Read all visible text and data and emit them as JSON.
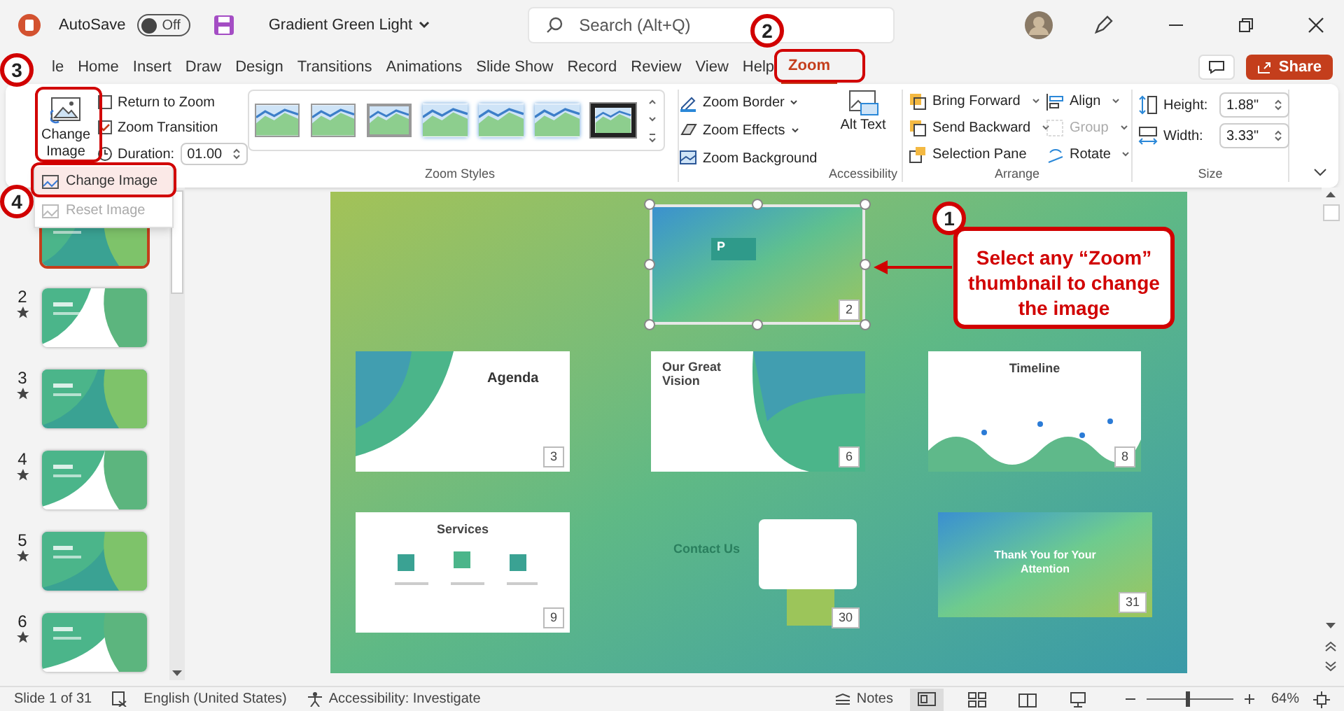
{
  "title_bar": {
    "autosave_label": "AutoSave",
    "autosave": {
      "on": false,
      "label": "Off"
    },
    "file_name": "Gradient Green Light",
    "search_placeholder": "Search (Alt+Q)"
  },
  "tabs": [
    {
      "label": "le",
      "selected": false
    },
    {
      "label": "Home",
      "selected": false
    },
    {
      "label": "Insert",
      "selected": false
    },
    {
      "label": "Draw",
      "selected": false
    },
    {
      "label": "Design",
      "selected": false
    },
    {
      "label": "Transitions",
      "selected": false
    },
    {
      "label": "Animations",
      "selected": false
    },
    {
      "label": "Slide Show",
      "selected": false
    },
    {
      "label": "Record",
      "selected": false
    },
    {
      "label": "Review",
      "selected": false
    },
    {
      "label": "View",
      "selected": false
    },
    {
      "label": "Help",
      "selected": false
    },
    {
      "label": "Zoom",
      "selected": true
    }
  ],
  "share_label": "Share",
  "ribbon": {
    "change_image": {
      "label": "Change Image"
    },
    "options": [
      {
        "label": "Return to Zoom",
        "checked": false
      },
      {
        "label": "Zoom Transition",
        "checked": true
      }
    ],
    "duration": {
      "label": "Duration:",
      "value": "01.00"
    },
    "zoom_styles": {
      "styles": [
        {
          "kind": "thin"
        },
        {
          "kind": "thin"
        },
        {
          "kind": "gray"
        },
        {
          "kind": "soft"
        },
        {
          "kind": "soft"
        },
        {
          "kind": "soft"
        },
        {
          "kind": "black"
        }
      ],
      "buttons": [
        {
          "label": "Zoom Border"
        },
        {
          "label": "Zoom Effects"
        },
        {
          "label": "Zoom Background"
        }
      ],
      "label": "Zoom Styles"
    },
    "accessibility": {
      "button": "Alt Text",
      "label": "Accessibility"
    },
    "arrange": {
      "items": [
        {
          "label": "Bring Forward",
          "disabled": false
        },
        {
          "label": "Send Backward",
          "disabled": false
        },
        {
          "label": "Selection Pane",
          "disabled": false
        },
        {
          "label": "Align",
          "disabled": false
        },
        {
          "label": "Group",
          "disabled": true
        },
        {
          "label": "Rotate",
          "disabled": false
        }
      ],
      "label": "Arrange"
    },
    "size": {
      "fields": [
        {
          "label": "Height:",
          "value": "1.88\""
        },
        {
          "label": "Width:",
          "value": "3.33\""
        }
      ],
      "label": "Size"
    }
  },
  "image_menu": [
    {
      "label": "Change Image",
      "selected": true,
      "disabled": false
    },
    {
      "label": "Reset Image",
      "selected": false,
      "disabled": true
    }
  ],
  "slides": [
    {
      "selected": true
    },
    {
      "number": "2",
      "selected": false
    },
    {
      "number": "3",
      "selected": false
    },
    {
      "number": "4",
      "selected": false
    },
    {
      "number": "5",
      "selected": false
    },
    {
      "number": "6",
      "selected": false
    }
  ],
  "zooms": [
    {
      "number": "2",
      "kind": "gradient",
      "title": "P",
      "selected": true
    },
    {
      "number": "3",
      "kind": "split-left",
      "title": "Agenda",
      "selected": false
    },
    {
      "number": "6",
      "kind": "split-right",
      "title": "Our Great Vision",
      "selected": false
    },
    {
      "number": "8",
      "kind": "wave",
      "title": "Timeline",
      "selected": false
    },
    {
      "number": "9",
      "kind": "white",
      "title": "Services",
      "selected": false
    },
    {
      "number": "30",
      "kind": "contact",
      "title": "Contact Us",
      "selected": false
    },
    {
      "number": "31",
      "kind": "closing",
      "title": "Thank You for Your Attention",
      "selected": false
    }
  ],
  "callouts": [
    {
      "number": "1",
      "text": "Select any “Zoom” thumbnail to change the image"
    },
    {
      "number": "2"
    },
    {
      "number": "3"
    },
    {
      "number": "4"
    }
  ],
  "status_bar": {
    "slide": "Slide 1 of 31",
    "language": "English (United States)",
    "accessibility": "Accessibility: Investigate",
    "notes": "Notes",
    "views": [
      {
        "selected": true
      },
      {
        "selected": false
      },
      {
        "selected": false
      },
      {
        "selected": false
      }
    ],
    "zoom": {
      "level": 0.45,
      "label": "64%"
    }
  }
}
